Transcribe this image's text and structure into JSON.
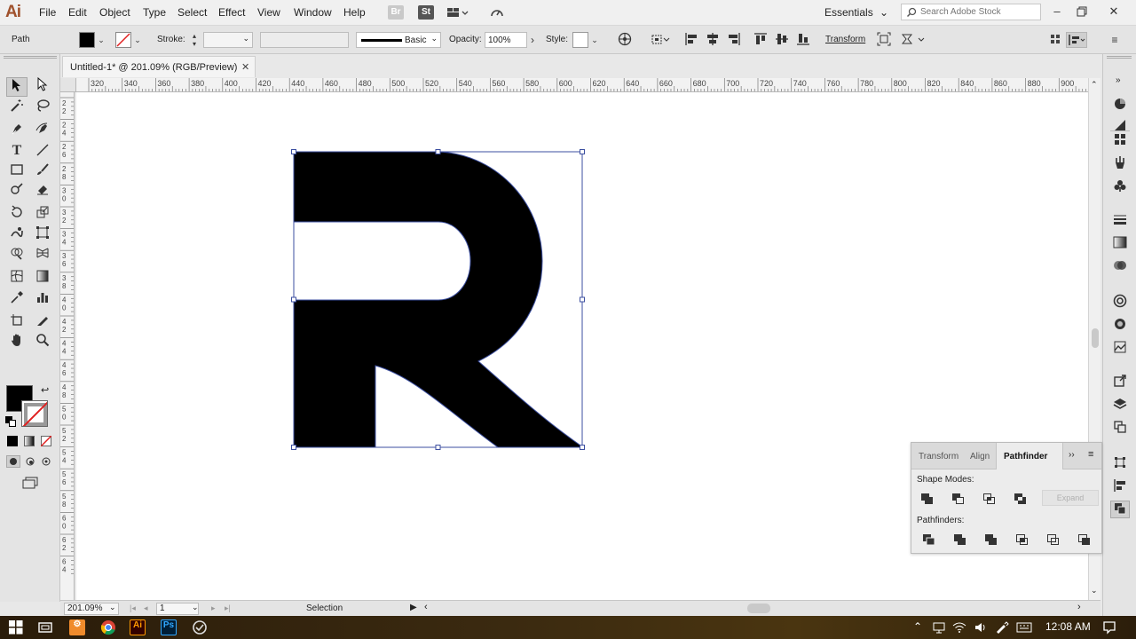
{
  "app": {
    "logo": "Ai",
    "menu": [
      "File",
      "Edit",
      "Object",
      "Type",
      "Select",
      "Effect",
      "View",
      "Window",
      "Help"
    ],
    "workspace": "Essentials",
    "stock_search_placeholder": "Search Adobe Stock",
    "window_controls": [
      "minimize-icon",
      "restore-icon",
      "close-icon"
    ],
    "menu_icons": [
      "bridge-icon",
      "stock-icon",
      "arrange-documents-icon",
      "gpu-performance-icon"
    ]
  },
  "control_bar": {
    "selection_type": "Path",
    "fill_color": "#000000",
    "stroke_label": "Stroke:",
    "stroke_value": "",
    "brush_label": "Basic",
    "opacity_label": "Opacity:",
    "opacity_value": "100%",
    "style_label": "Style:",
    "transform_label": "Transform"
  },
  "document": {
    "tab_title": "Untitled-1* @ 201.09% (RGB/Preview)",
    "zoom": "201.09%",
    "artboard": "1",
    "status_tool": "Selection"
  },
  "ruler": {
    "h_labels": [
      "320",
      "340",
      "360",
      "380",
      "400",
      "420",
      "440",
      "460",
      "480",
      "500",
      "520",
      "540",
      "560",
      "580",
      "600",
      "620",
      "640",
      "660",
      "680",
      "700",
      "720",
      "740",
      "760",
      "780",
      "800",
      "820",
      "840",
      "860",
      "880",
      "900"
    ],
    "v_labels": [
      "2 2",
      "2 4",
      "2 6",
      "2 8",
      "3 0",
      "3 2",
      "3 4",
      "3 6",
      "3 8",
      "4 0",
      "4 2",
      "4 4",
      "4 6",
      "4 8",
      "5 0",
      "5 2",
      "5 4",
      "5 6",
      "5 8",
      "6 0",
      "6 2",
      "6 4"
    ]
  },
  "artwork": {
    "shape": "letter-r-path",
    "fill": "#000000",
    "selection_color": "#3c4fa0"
  },
  "tools": [
    "selection-tool-icon",
    "direct-selection-tool-icon",
    "magic-wand-tool-icon",
    "lasso-tool-icon",
    "pen-tool-icon",
    "curvature-tool-icon",
    "type-tool-icon",
    "line-segment-tool-icon",
    "rectangle-tool-icon",
    "paintbrush-tool-icon",
    "shaper-tool-icon",
    "eraser-tool-icon",
    "rotate-tool-icon",
    "scale-tool-icon",
    "warp-tool-icon",
    "free-transform-tool-icon",
    "shape-builder-tool-icon",
    "perspective-grid-tool-icon",
    "mesh-tool-icon",
    "gradient-tool-icon",
    "eyedropper-tool-icon",
    "column-graph-tool-icon",
    "artboard-tool-icon",
    "slice-tool-icon",
    "hand-tool-icon",
    "zoom-tool-icon"
  ],
  "pathfinder": {
    "tabs": [
      "Transform",
      "Align",
      "Pathfinder"
    ],
    "active_tab": "Pathfinder",
    "shape_modes_label": "Shape Modes:",
    "pathfinders_label": "Pathfinders:",
    "expand_label": "Expand",
    "shape_mode_buttons": [
      "unite-icon",
      "minus-front-icon",
      "intersect-icon",
      "exclude-icon"
    ],
    "pathfinder_buttons": [
      "divide-icon",
      "trim-icon",
      "merge-icon",
      "crop-icon",
      "outline-icon",
      "minus-back-icon"
    ]
  },
  "right_panels": [
    "color-panel-icon",
    "color-guide-icon",
    "swatches-panel-icon",
    "brushes-panel-icon",
    "symbols-panel-icon",
    "stroke-panel-icon",
    "gradient-panel-icon",
    "transparency-panel-icon",
    "appearance-panel-icon",
    "graphic-styles-panel-icon",
    "image-trace-icon",
    "asset-export-icon",
    "layers-panel-icon",
    "artboards-panel-icon",
    "transform-panel-icon",
    "align-panel-icon",
    "pathfinder-panel-icon"
  ],
  "taskbar": {
    "time": "12:08 AM",
    "apps": [
      "windows-start-icon",
      "task-view-icon",
      "file-explorer-icon",
      "chrome-icon",
      "illustrator-icon",
      "photoshop-icon",
      "taskbar-app-icon"
    ],
    "tray": [
      "tray-chevron-up-icon",
      "network-icon",
      "wifi-icon",
      "volume-icon",
      "pen-icon",
      "keyboard-icon",
      "notifications-icon"
    ]
  },
  "colors": {
    "illustrator_brand": "#ff9a00",
    "photoshop_brand": "#31a8ff",
    "canvas_bg": "#ffffff",
    "panel_bg": "#e4e4e4"
  }
}
